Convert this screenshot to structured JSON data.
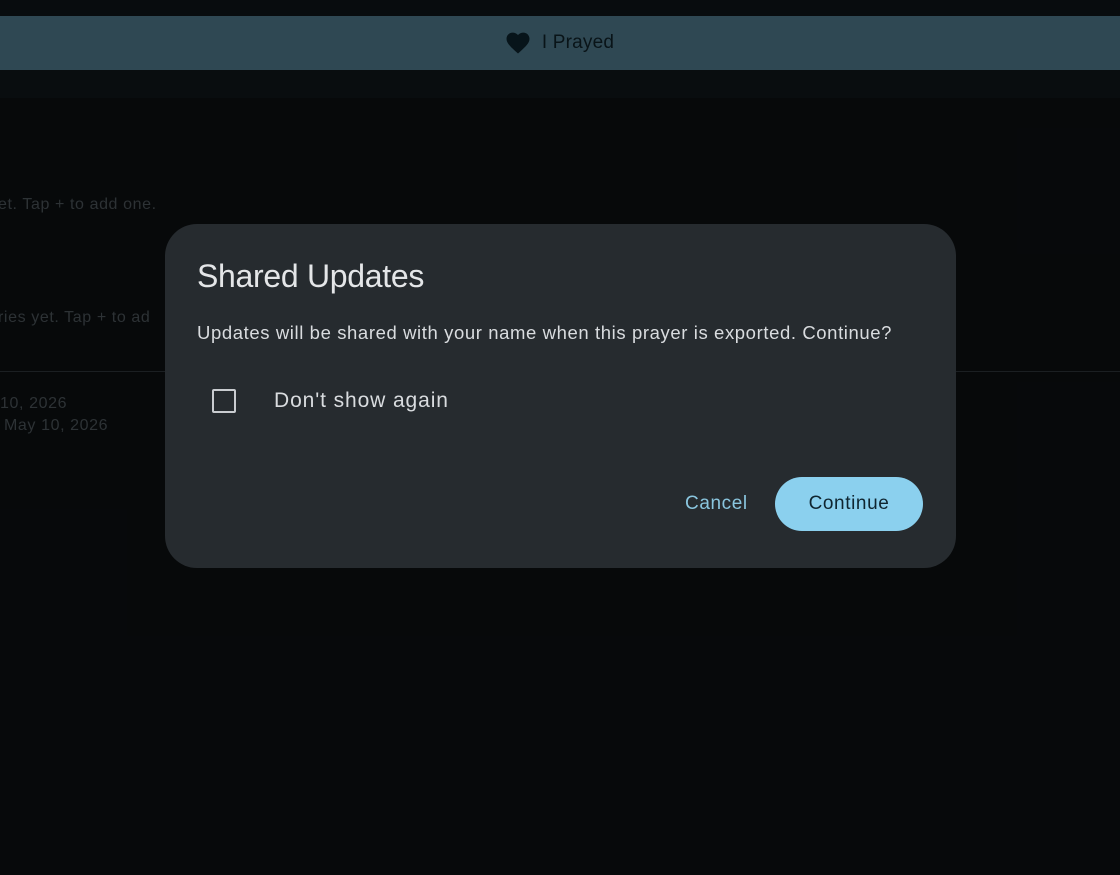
{
  "prayed_bar": {
    "icon": "heart-icon",
    "label": "I Prayed",
    "color": "#426473"
  },
  "background": {
    "empty_message_1": "et. Tap + to add one.",
    "empty_message_2": "ries yet. Tap + to ad",
    "date_1": "10, 2026",
    "date_2": "May 10, 2026"
  },
  "dialog": {
    "title": "Shared Updates",
    "message": "Updates will be shared with your name when this prayer is exported. Continue?",
    "checkbox_label": "Don't show again",
    "checkbox_checked": false,
    "cancel_label": "Cancel",
    "continue_label": "Continue",
    "accent_color": "#8bd0ee"
  }
}
